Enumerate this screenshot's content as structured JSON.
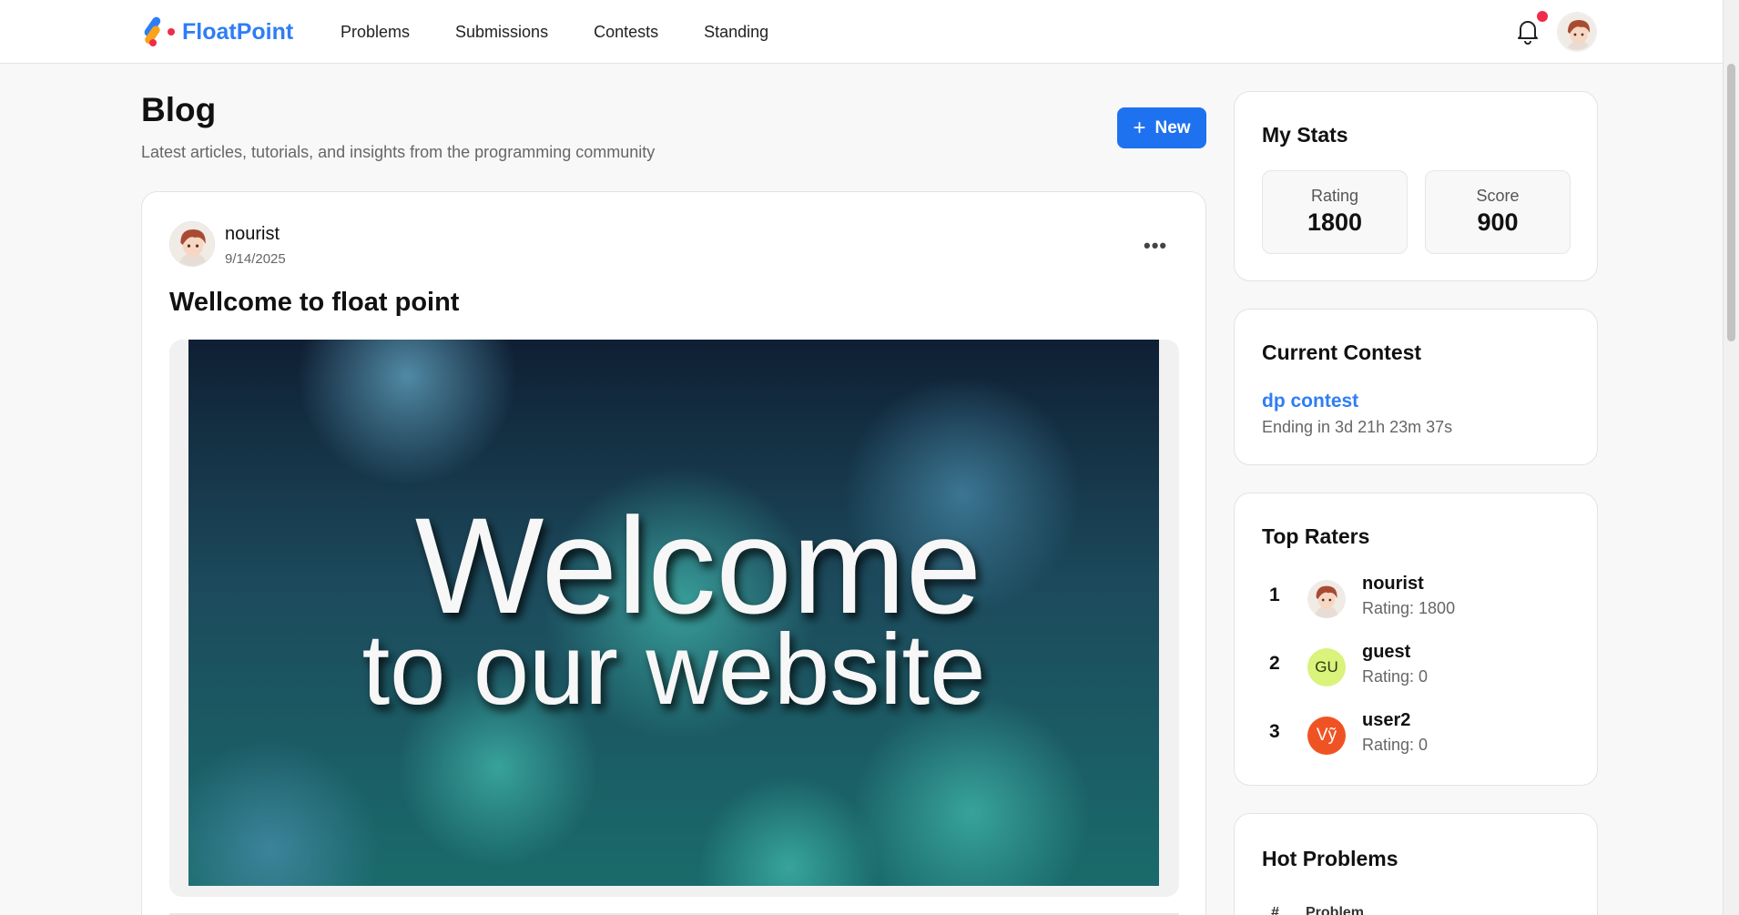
{
  "app": {
    "name": "FloatPoint"
  },
  "nav": {
    "items": [
      {
        "label": "Problems"
      },
      {
        "label": "Submissions"
      },
      {
        "label": "Contests"
      },
      {
        "label": "Standing"
      }
    ]
  },
  "header": {
    "bell_icon": "bell-icon",
    "has_notification": true
  },
  "blog": {
    "title": "Blog",
    "subtitle": "Latest articles, tutorials, and insights from the programming community",
    "new_button": "New"
  },
  "post": {
    "author": "nourist",
    "date": "9/14/2025",
    "title": "Wellcome to float point",
    "image_text_line1": "Welcome",
    "image_text_line2": "to our  website"
  },
  "stats": {
    "title": "My Stats",
    "rating_label": "Rating",
    "rating_value": "1800",
    "score_label": "Score",
    "score_value": "900"
  },
  "contest": {
    "title": "Current Contest",
    "name": "dp contest",
    "timer": "Ending in 3d 21h 23m 37s"
  },
  "top_raters": {
    "title": "Top Raters",
    "items": [
      {
        "rank": "1",
        "name": "nourist",
        "rating": "Rating: 1800",
        "initials": ""
      },
      {
        "rank": "2",
        "name": "guest",
        "rating": "Rating: 0",
        "initials": "GU"
      },
      {
        "rank": "3",
        "name": "user2",
        "rating": "Rating: 0",
        "initials": "Vỹ"
      }
    ]
  },
  "hot_problems": {
    "title": "Hot Problems",
    "col_num": "#",
    "col_problem": "Problem"
  },
  "colors": {
    "accent": "#1e72f0",
    "brand": "#2f7df6",
    "notification": "#ef2d4b",
    "avatar_guest": "#d9f37b",
    "avatar_user2": "#f05323"
  }
}
